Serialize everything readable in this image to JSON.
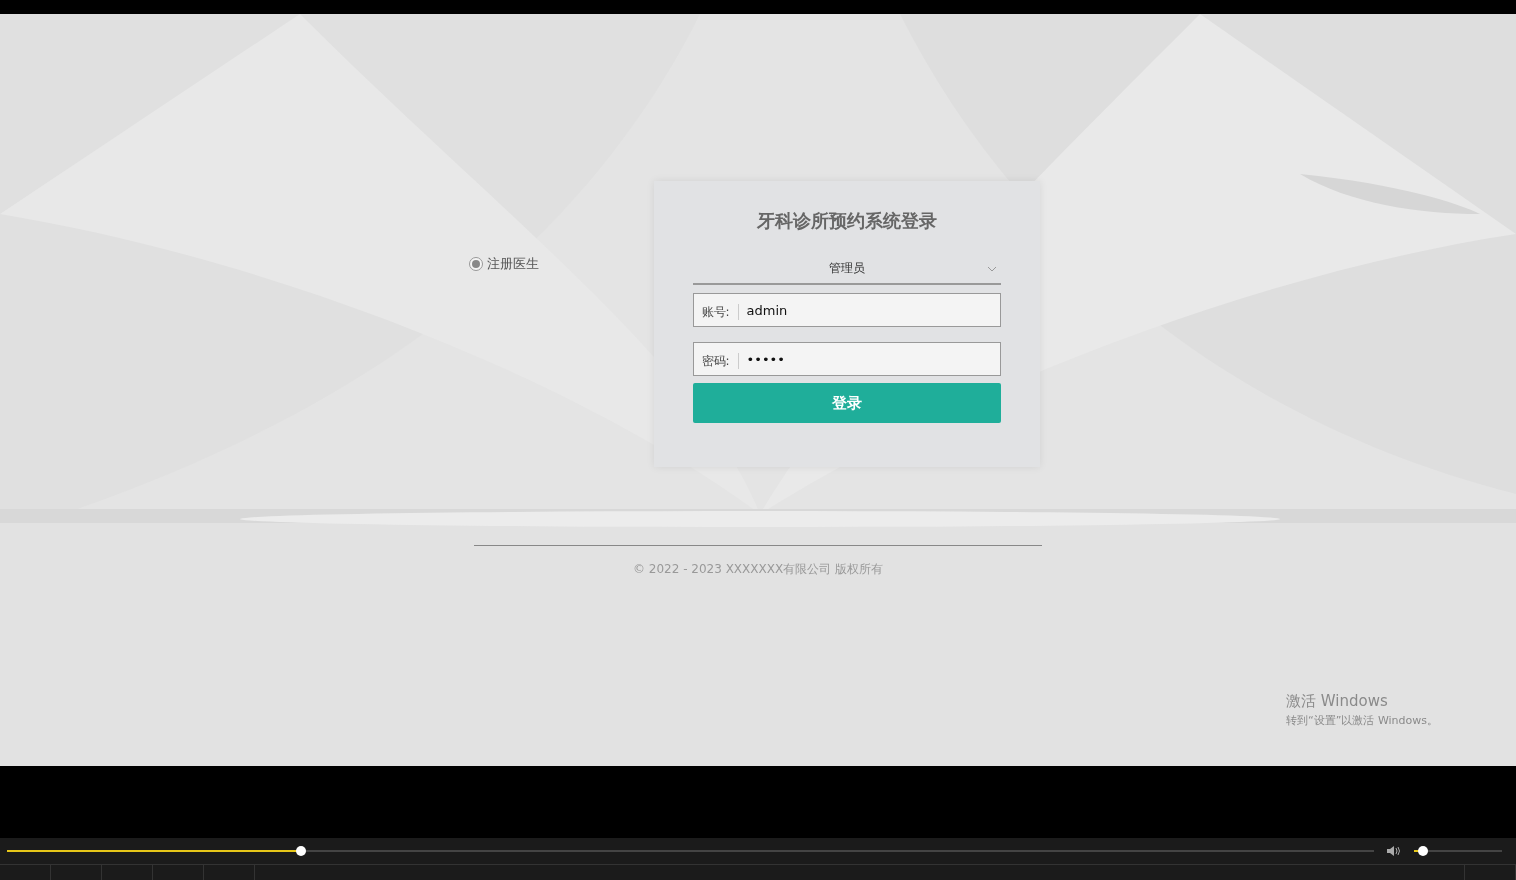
{
  "login": {
    "register_option": {
      "label": "注册医生",
      "selected": true
    },
    "title": "牙科诊所预约系统登录",
    "role_select": {
      "value": "管理员"
    },
    "account": {
      "label": "账号:",
      "value": "admin"
    },
    "password": {
      "label": "密码:",
      "value": "•••••"
    },
    "submit": "登录"
  },
  "footer": {
    "copyright": "© 2022 - 2023 XXXXXXX有限公司 版权所有"
  },
  "os_notice": {
    "title": "激活 Windows",
    "hint": "转到“设置”以激活 Windows。"
  },
  "player": {
    "progress": {
      "level": 0.215
    },
    "volume": {
      "level": 0.1
    }
  }
}
